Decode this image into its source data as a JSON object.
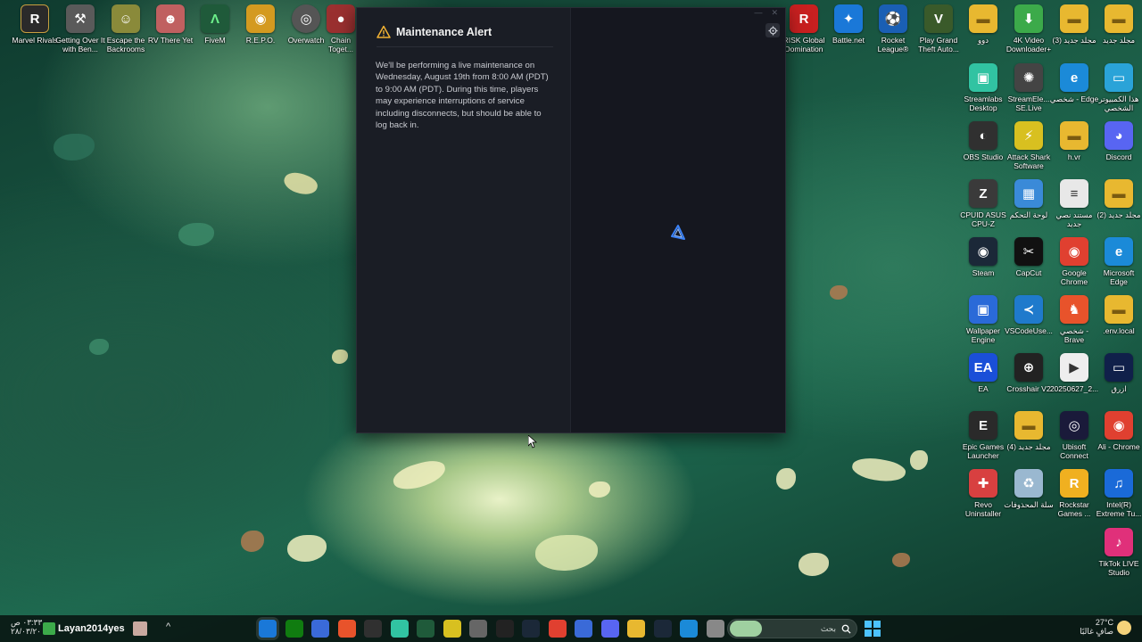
{
  "desktop": {
    "left_icons": [
      {
        "label": "Marvel Rivals",
        "icon": "marvel-rivals-icon",
        "color": "#2a2a2a",
        "glyph": "R"
      },
      {
        "label": "Getting Over It with Ben...",
        "icon": "hammer-icon",
        "color": "#5a5a5a",
        "glyph": "⚒"
      },
      {
        "label": "Escape the Backrooms",
        "icon": "backrooms-icon",
        "color": "#8a8a3a",
        "glyph": "☺"
      },
      {
        "label": "RV There Yet",
        "icon": "rv-there-yet-icon",
        "color": "#c06060",
        "glyph": "☻"
      },
      {
        "label": "FiveM",
        "icon": "fivem-icon",
        "color": "#1f5a3a",
        "glyph": "Λ"
      },
      {
        "label": "R.E.P.O.",
        "icon": "repo-icon",
        "color": "#d49a20",
        "glyph": "◉"
      },
      {
        "label": "Overwatch",
        "icon": "overwatch-icon",
        "color": "#555555",
        "glyph": "◎"
      },
      {
        "label": "Chain Toget...",
        "icon": "chained-together-icon",
        "color": "#9a3030",
        "glyph": "●"
      }
    ],
    "right_icons": [
      {
        "label": "RISK Global Domination",
        "icon": "risk-icon",
        "color": "#c82020",
        "glyph": "R"
      },
      {
        "label": "Battle.net",
        "icon": "battlenet-icon",
        "color": "#1a78d8",
        "glyph": "✦"
      },
      {
        "label": "Rocket League®",
        "icon": "rocket-league-icon",
        "color": "#1a5fb4",
        "glyph": "⚽"
      },
      {
        "label": "Play Grand Theft Auto...",
        "icon": "gta-icon",
        "color": "#3a5a2a",
        "glyph": "V"
      },
      {
        "label": "دوو",
        "icon": "folder-icon",
        "color": "#e8b830",
        "glyph": "▬"
      },
      {
        "label": "4K Video Downloader+",
        "icon": "4k-downloader-icon",
        "color": "#3caa4a",
        "glyph": "⬇"
      },
      {
        "label": "مجلد جديد (3)",
        "icon": "folder-icon",
        "color": "#e8b830",
        "glyph": "▬"
      },
      {
        "label": "مجلد جديد",
        "icon": "folder-icon",
        "color": "#e8b830",
        "glyph": "▬"
      },
      {
        "label": "Streamlabs Desktop",
        "icon": "streamlabs-icon",
        "color": "#31c3a2",
        "glyph": "▣"
      },
      {
        "label": "StreamEle... SE.Live",
        "icon": "streamelements-icon",
        "color": "#444444",
        "glyph": "✺"
      },
      {
        "label": "شخصي - Edge",
        "icon": "edge-icon",
        "color": "#1b8ad8",
        "glyph": "e"
      },
      {
        "label": "هذا الكمبيوتر الشخصي",
        "icon": "this-pc-icon",
        "color": "#2aa3d8",
        "glyph": "▭"
      },
      {
        "label": "OBS Studio",
        "icon": "obs-icon",
        "color": "#303030",
        "glyph": "◐"
      },
      {
        "label": "Attack Shark Software",
        "icon": "attack-shark-icon",
        "color": "#d8c020",
        "glyph": "⚡"
      },
      {
        "label": "h.vr",
        "icon": "folder-icon",
        "color": "#e8b830",
        "glyph": "▬"
      },
      {
        "label": "Discord",
        "icon": "discord-icon",
        "color": "#5865f2",
        "glyph": "◕"
      },
      {
        "label": "CPUID ASUS CPU-Z",
        "icon": "cpuz-icon",
        "color": "#3a3a3a",
        "glyph": "Z"
      },
      {
        "label": "لوحة التحكم",
        "icon": "control-panel-icon",
        "color": "#3a8ad8",
        "glyph": "▦"
      },
      {
        "label": "مستند نصي جديد",
        "icon": "text-document-icon",
        "color": "#e8e8e8",
        "glyph": "≡"
      },
      {
        "label": "مجلد جديد (2)",
        "icon": "folder-icon",
        "color": "#e8b830",
        "glyph": "▬"
      },
      {
        "label": "Steam",
        "icon": "steam-icon",
        "color": "#1b2838",
        "glyph": "◉"
      },
      {
        "label": "CapCut",
        "icon": "capcut-icon",
        "color": "#111111",
        "glyph": "✂"
      },
      {
        "label": "Google Chrome",
        "icon": "chrome-icon",
        "color": "#e04030",
        "glyph": "◉"
      },
      {
        "label": "Microsoft Edge",
        "icon": "edge-icon",
        "color": "#1b8ad8",
        "glyph": "e"
      },
      {
        "label": "Wallpaper Engine",
        "icon": "wallpaper-engine-icon",
        "color": "#2a6ad8",
        "glyph": "▣"
      },
      {
        "label": "VSCodeUse...",
        "icon": "vscode-icon",
        "color": "#1f7acc",
        "glyph": "≺"
      },
      {
        "label": "شخصي - Brave",
        "icon": "brave-icon",
        "color": "#e8532b",
        "glyph": "♞"
      },
      {
        "label": ".env.local",
        "icon": "folder-icon",
        "color": "#e8b830",
        "glyph": "▬"
      },
      {
        "label": "EA",
        "icon": "ea-icon",
        "color": "#1a4fd8",
        "glyph": "EA"
      },
      {
        "label": "Crosshair V2",
        "icon": "crosshair-icon",
        "color": "#222222",
        "glyph": "⊕"
      },
      {
        "label": "20250627_2...",
        "icon": "video-file-icon",
        "color": "#eeeeee",
        "glyph": "▶"
      },
      {
        "label": "ازرق",
        "icon": "image-file-icon",
        "color": "#10204a",
        "glyph": "▭"
      },
      {
        "label": "Epic Games Launcher",
        "icon": "epic-games-icon",
        "color": "#2a2a2a",
        "glyph": "E"
      },
      {
        "label": "مجلد جديد (4)",
        "icon": "folder-icon",
        "color": "#e8b830",
        "glyph": "▬"
      },
      {
        "label": "Ubisoft Connect",
        "icon": "ubisoft-icon",
        "color": "#1a1a3a",
        "glyph": "◎"
      },
      {
        "label": "Ali - Chrome",
        "icon": "chrome-icon",
        "color": "#e04030",
        "glyph": "◉"
      },
      {
        "label": "Revo Uninstaller",
        "icon": "revo-uninstaller-icon",
        "color": "#d84040",
        "glyph": "✚"
      },
      {
        "label": "سلة المحذوفات",
        "icon": "recycle-bin-icon",
        "color": "#9ab8d0",
        "glyph": "♻"
      },
      {
        "label": "Rockstar Games ...",
        "icon": "rockstar-icon",
        "color": "#f0b020",
        "glyph": "R"
      },
      {
        "label": "Intel(R) Extreme Tu...",
        "icon": "intel-xtu-icon",
        "color": "#1a6ad8",
        "glyph": "♫"
      },
      {
        "label": "TikTok LIVE Studio",
        "icon": "tiktok-icon",
        "color": "#e0307a",
        "glyph": "♪"
      }
    ]
  },
  "launcher": {
    "alert_title": "Maintenance Alert",
    "alert_body": "We'll be performing a live maintenance on Wednesday, August 19th from 8:00 AM (PDT) to 9:00 AM (PDT). During this time, players may experience interruptions of service including disconnects, but should be able to log back in.",
    "accent_color": "#3b82f6"
  },
  "taskbar": {
    "username": "Layan2014yes",
    "clock_time": "٠٣:٣٣ ص",
    "clock_date": "٢٨/٠٣/٢٠",
    "search_placeholder": "بحث",
    "weather_temp": "27°C",
    "weather_desc": "صافٍ غالبًا",
    "apps": [
      {
        "icon": "battlenet-taskbar-icon",
        "color": "#1a78d8"
      },
      {
        "icon": "xbox-taskbar-icon",
        "color": "#107c10"
      },
      {
        "icon": "app-taskbar-icon",
        "color": "#3a6ad8"
      },
      {
        "icon": "brave-taskbar-icon",
        "color": "#e8532b"
      },
      {
        "icon": "obs-taskbar-icon",
        "color": "#303030"
      },
      {
        "icon": "streamlabs-taskbar-icon",
        "color": "#31c3a2"
      },
      {
        "icon": "fivem-taskbar-icon",
        "color": "#1f5a3a"
      },
      {
        "icon": "attack-shark-taskbar-icon",
        "color": "#d8c020"
      },
      {
        "icon": "tools-taskbar-icon",
        "color": "#666666"
      },
      {
        "icon": "game-taskbar-icon",
        "color": "#222222"
      },
      {
        "icon": "steam-taskbar-icon",
        "color": "#1b2838"
      },
      {
        "icon": "chrome-taskbar-icon",
        "color": "#e04030"
      },
      {
        "icon": "store-taskbar-icon",
        "color": "#3a6ad8"
      },
      {
        "icon": "discord-taskbar-icon",
        "color": "#5865f2"
      },
      {
        "icon": "explorer-taskbar-icon",
        "color": "#e8b830"
      },
      {
        "icon": "steam-taskbar-icon",
        "color": "#1b2838"
      },
      {
        "icon": "edge-taskbar-icon",
        "color": "#1b8ad8"
      },
      {
        "icon": "app-taskbar-icon",
        "color": "#888888"
      }
    ]
  }
}
